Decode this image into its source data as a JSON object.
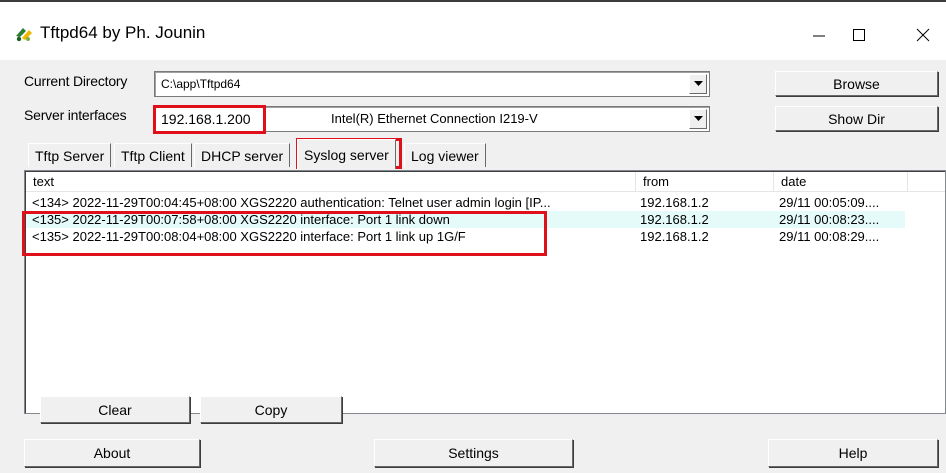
{
  "window": {
    "title": "Tftpd64 by Ph. Jounin",
    "icon": "tftpd-app-icon"
  },
  "caption": {
    "minimize": "minimize-icon",
    "maximize": "maximize-icon",
    "close": "close-icon"
  },
  "current_directory": {
    "label": "Current Directory",
    "value": "C:\\app\\Tftpd64"
  },
  "server_interfaces": {
    "label": "Server interfaces",
    "ip": "192.168.1.200",
    "adapter": "Intel(R) Ethernet Connection I219-V"
  },
  "buttons": {
    "browse": "Browse",
    "show_dir": "Show Dir",
    "clear": "Clear",
    "copy": "Copy",
    "about": "About",
    "settings": "Settings",
    "help": "Help"
  },
  "tabs": [
    {
      "label": "Tftp Server",
      "active": false
    },
    {
      "label": "Tftp Client",
      "active": false
    },
    {
      "label": "DHCP server",
      "active": false
    },
    {
      "label": "Syslog server",
      "active": true
    },
    {
      "label": "Log viewer",
      "active": false
    }
  ],
  "syslog": {
    "columns": [
      "text",
      "from",
      "date"
    ],
    "rows": [
      {
        "text": "<134> 2022-11-29T00:04:45+08:00 XGS2220 authentication: Telnet user admin login [IP...",
        "from": "192.168.1.2",
        "date": "29/11 00:05:09....",
        "selected": false
      },
      {
        "text": "<135> 2022-11-29T00:07:58+08:00 XGS2220 interface: Port 1 link down",
        "from": "192.168.1.2",
        "date": "29/11 00:08:23....",
        "selected": true
      },
      {
        "text": "<135> 2022-11-29T00:08:04+08:00 XGS2220 interface: Port 1 link up 1G/F",
        "from": "192.168.1.2",
        "date": "29/11 00:08:29....",
        "selected": false
      }
    ]
  },
  "colors": {
    "highlight_box": "#e0101a",
    "selected_row": "#e5fbfa",
    "background": "#f0f0f0"
  }
}
